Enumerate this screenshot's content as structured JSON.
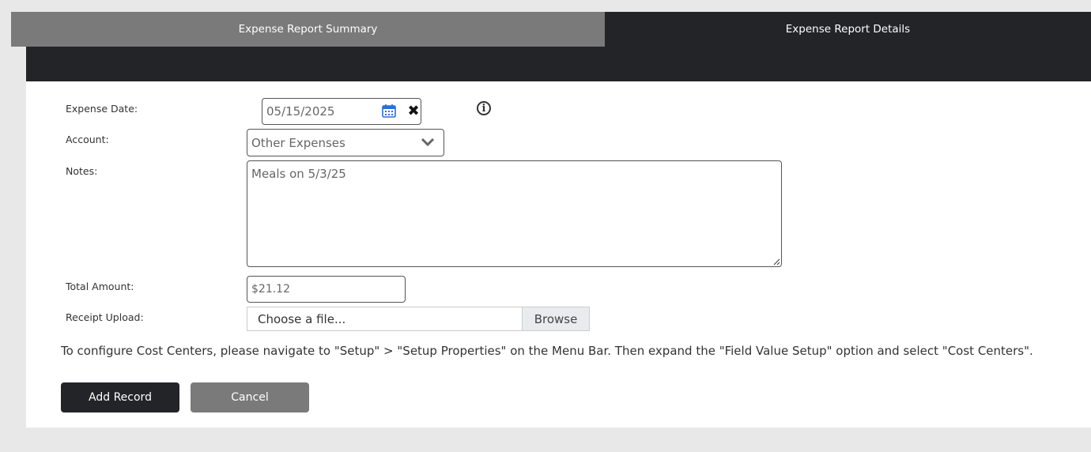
{
  "tabs": {
    "summary": "Expense Report Summary",
    "details": "Expense Report Details"
  },
  "form": {
    "expense_date_label": "Expense Date:",
    "expense_date_value": "05/15/2025",
    "account_label": "Account:",
    "account_value": "Other Expenses",
    "notes_label": "Notes:",
    "notes_value": "Meals on 5/3/25",
    "total_amount_label": "Total Amount:",
    "total_amount_value": "$21.12",
    "receipt_label": "Receipt Upload:",
    "file_placeholder": "Choose a file...",
    "browse_label": "Browse"
  },
  "instructions": "To configure Cost Centers, please navigate to \"Setup\" > \"Setup Properties\" on the Menu Bar. Then expand the \"Field Value Setup\" option and select \"Cost Centers\".",
  "buttons": {
    "add": "Add Record",
    "cancel": "Cancel"
  },
  "icons": {
    "date": "calendar-icon",
    "clear": "clear-icon",
    "info": "info-icon",
    "dropdown": "chevron-down-icon"
  },
  "colors": {
    "dark": "#232427",
    "gray": "#7a7a7a",
    "calendar": "#2b6fd6"
  }
}
